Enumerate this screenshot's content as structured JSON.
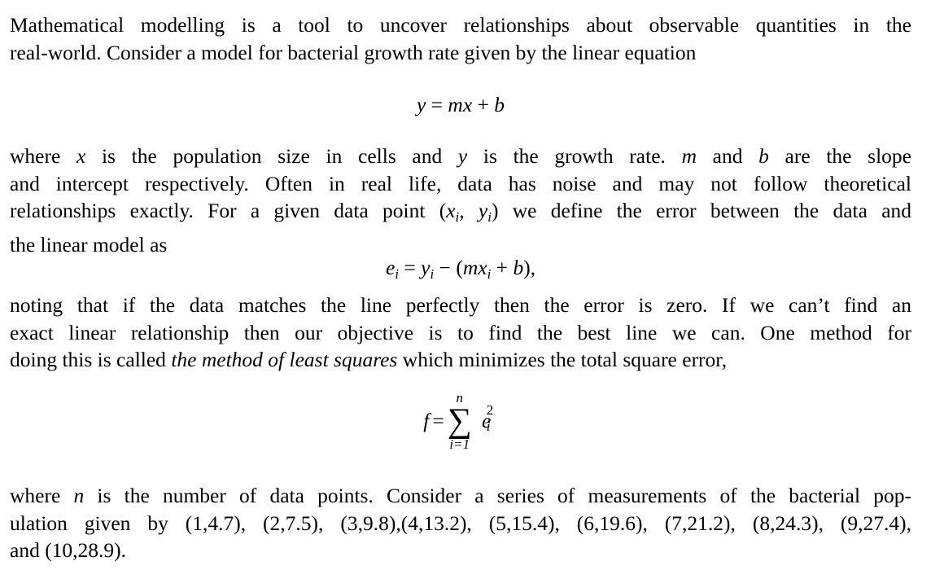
{
  "document": {
    "para1": {
      "lines": [
        "Mathematical modelling is a tool to uncover relationships about observable quantities in the",
        "real-world. Consider a model for bacterial growth rate given by the linear equation"
      ]
    },
    "eq1": {
      "lhs": "y",
      "op": "=",
      "rhs_m": "mx",
      "plus": "+",
      "rhs_b": "b"
    },
    "para2": {
      "l1_a": "where ",
      "l1_x": "x",
      "l1_b": " is the population size in cells and ",
      "l1_y": "y",
      "l1_c": " is the growth rate.  ",
      "l1_m": "m",
      "l1_d": " and ",
      "l1_bb": "b",
      "l1_e": " are the slope",
      "l2": "and intercept respectively. Often in real life, data has noise and may not follow theoretical",
      "l3_a": "relationships exactly. For a given data point (",
      "l3_x": "x",
      "l3_i1": "i",
      "l3_comma": ", ",
      "l3_y": "y",
      "l3_i2": "i",
      "l3_b": ") we define the error between the data and",
      "l4": "the linear model as"
    },
    "eq2": {
      "e": "e",
      "i": "i",
      "eq": " = ",
      "y": "y",
      "i2": "i",
      "minus": " − (",
      "mx": "mx",
      "i3": "i",
      "rest": " + ",
      "b": "b",
      "close": "),"
    },
    "para3": {
      "l1": "noting that if the data matches the line perfectly then the error is zero. If we can’t find an",
      "l2": "exact linear relationship then our objective is to find the best line we can. One method for",
      "l3_a": "doing this is called ",
      "l3_em": "the method of least squares",
      "l3_b": " which minimizes the total square error,"
    },
    "eq3": {
      "f": "f",
      "eq": " = ",
      "sum": "∑",
      "upper": "n",
      "lower": "i=1",
      "e": "e",
      "sup": "2",
      "sub": "i"
    },
    "para4": {
      "l1_a": "where ",
      "l1_n": "n",
      "l1_b": " is the number of data points. Consider a series of measurements of the bacterial pop-",
      "l2": "ulation given by (1,4.7), (2,7.5), (3,9.8),(4,13.2), (5,15.4), (6,19.6), (7,21.2), (8,24.3), (9,27.4),",
      "l3": "and (10,28.9)."
    },
    "data_points": [
      [
        1,
        4.7
      ],
      [
        2,
        7.5
      ],
      [
        3,
        9.8
      ],
      [
        4,
        13.2
      ],
      [
        5,
        15.4
      ],
      [
        6,
        19.6
      ],
      [
        7,
        21.2
      ],
      [
        8,
        24.3
      ],
      [
        9,
        27.4
      ],
      [
        10,
        28.9
      ]
    ]
  }
}
